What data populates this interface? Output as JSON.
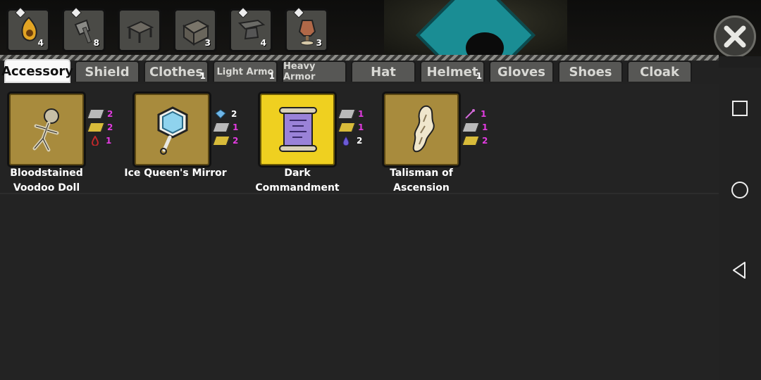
{
  "stations": [
    {
      "icon": "lantern-station-icon",
      "count": "4"
    },
    {
      "icon": "axe-station-icon",
      "count": "8"
    },
    {
      "icon": "workbench-station-icon",
      "count": ""
    },
    {
      "icon": "lumber-station-icon",
      "count": "3"
    },
    {
      "icon": "anvil-station-icon",
      "count": "4"
    },
    {
      "icon": "tailoring-station-icon",
      "count": "3"
    }
  ],
  "tabs": [
    {
      "label": "Accessory",
      "count": "",
      "active": true
    },
    {
      "label": "Shield",
      "count": ""
    },
    {
      "label": "Clothes",
      "count": "1"
    },
    {
      "label": "Light Armo",
      "count": "1"
    },
    {
      "label": "Heavy Armor",
      "count": ""
    },
    {
      "label": "Hat",
      "count": ""
    },
    {
      "label": "Helmet",
      "count": "1"
    },
    {
      "label": "Gloves",
      "count": ""
    },
    {
      "label": "Shoes",
      "count": ""
    },
    {
      "label": "Cloak",
      "count": ""
    }
  ],
  "items": [
    {
      "name": "Bloodstained Voodoo Doll",
      "icon": "voodoo-doll-icon",
      "materials": [
        {
          "type": "iron-ingot",
          "color": "#b9b9b9",
          "qty": "2"
        },
        {
          "type": "gold-ingot",
          "color": "#d8bb3a",
          "qty": "2"
        },
        {
          "type": "blood-drop",
          "color": "#c0282a",
          "qty": "1"
        }
      ]
    },
    {
      "name": "Ice Queen's Mirror",
      "icon": "ice-mirror-icon",
      "materials": [
        {
          "type": "ice-crystal",
          "color": "#6fb6e8",
          "qty": "2"
        },
        {
          "type": "iron-ingot",
          "color": "#b9b9b9",
          "qty": "1"
        },
        {
          "type": "gold-ingot",
          "color": "#d8bb3a",
          "qty": "2"
        }
      ]
    },
    {
      "name": "Dark Commandment",
      "icon": "dark-scroll-icon",
      "highlight": true,
      "materials": [
        {
          "type": "iron-ingot",
          "color": "#b9b9b9",
          "qty": "1"
        },
        {
          "type": "gold-ingot",
          "color": "#d8bb3a",
          "qty": "1"
        },
        {
          "type": "dark-essence",
          "color": "#6c5bd6",
          "qty": "2"
        }
      ]
    },
    {
      "name": "Talisman of Ascension",
      "icon": "talisman-paper-icon",
      "materials": [
        {
          "type": "magic-wand",
          "color": "#d36ad8",
          "qty": "1"
        },
        {
          "type": "iron-ingot",
          "color": "#b9b9b9",
          "qty": "1"
        },
        {
          "type": "gold-ingot",
          "color": "#d8bb3a",
          "qty": "2"
        }
      ]
    }
  ],
  "colors": {
    "accent_pink": "#e23be0",
    "highlight_gold": "#efd020",
    "panel": "#232323"
  }
}
